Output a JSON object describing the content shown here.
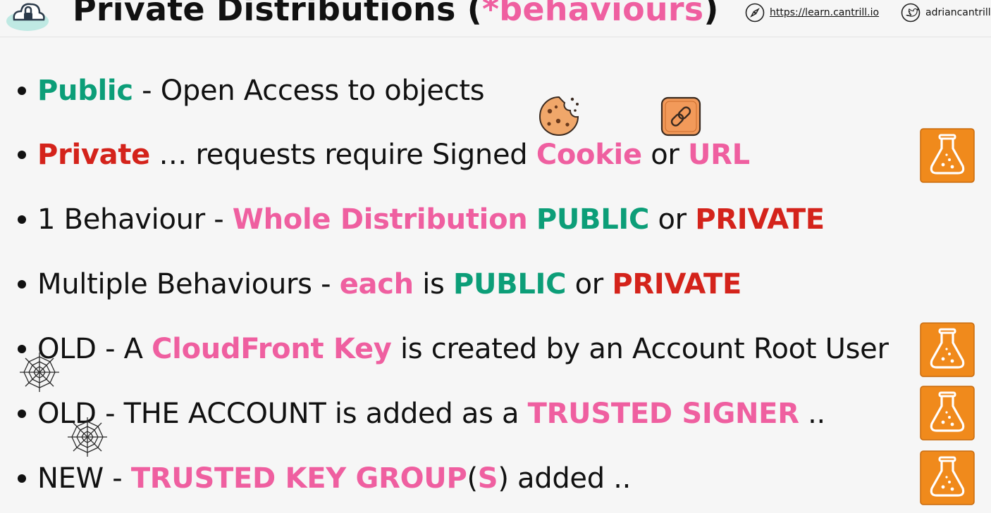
{
  "header": {
    "title_main": "Private Distributions (",
    "title_accent": "*behaviours",
    "title_close": ")",
    "website_url": "https://learn.cantrill.io",
    "twitter_handle": "adriancantrill",
    "icons": [
      "cloud-logo-icon",
      "compass-icon",
      "twitter-icon"
    ]
  },
  "bullets": [
    {
      "segments": [
        {
          "text": "Public",
          "style": "green b"
        },
        {
          "text": " - Open Access to objects",
          "style": ""
        }
      ]
    },
    {
      "segments": [
        {
          "text": "Private",
          "style": "red b"
        },
        {
          "text": " … requests require Signed ",
          "style": ""
        },
        {
          "text": "Cookie",
          "style": "pink b"
        },
        {
          "text": " or ",
          "style": ""
        },
        {
          "text": "URL",
          "style": "pink b"
        }
      ]
    },
    {
      "segments": [
        {
          "text": "1 Behaviour - ",
          "style": ""
        },
        {
          "text": "Whole Distribution",
          "style": "pink b"
        },
        {
          "text": " ",
          "style": ""
        },
        {
          "text": "PUBLIC",
          "style": "green b"
        },
        {
          "text": " or ",
          "style": ""
        },
        {
          "text": "PRIVATE",
          "style": "red b"
        }
      ]
    },
    {
      "segments": [
        {
          "text": "Multiple Behaviours - ",
          "style": ""
        },
        {
          "text": "each",
          "style": "pink b"
        },
        {
          "text": " is ",
          "style": ""
        },
        {
          "text": "PUBLIC",
          "style": "green b"
        },
        {
          "text": " or ",
          "style": ""
        },
        {
          "text": "PRIVATE",
          "style": "red b"
        }
      ]
    },
    {
      "segments": [
        {
          "text": "OLD - A ",
          "style": ""
        },
        {
          "text": "CloudFront Key",
          "style": "pink b"
        },
        {
          "text": " is created by an Account Root User",
          "style": ""
        }
      ]
    },
    {
      "segments": [
        {
          "text": "OLD - THE ACCOUNT is added as a ",
          "style": ""
        },
        {
          "text": "TRUSTED SIGNER",
          "style": "pink b"
        },
        {
          "text": " ..",
          "style": ""
        }
      ]
    },
    {
      "segments": [
        {
          "text": "NEW - ",
          "style": ""
        },
        {
          "text": "TRUSTED KEY GROUP",
          "style": "pink b"
        },
        {
          "text": "(",
          "style": ""
        },
        {
          "text": "S",
          "style": "pink b"
        },
        {
          "text": ") added ..",
          "style": ""
        }
      ]
    }
  ],
  "decorations": {
    "cookie": "cookie-icon",
    "link": "link-icon",
    "spider_web": "spider-web-icon",
    "lab": "lab-flask-icon"
  },
  "colors": {
    "pink": "#ef5fa0",
    "green": "#0c9e78",
    "red": "#d4231b",
    "flask_orange": "#f08a1c"
  }
}
